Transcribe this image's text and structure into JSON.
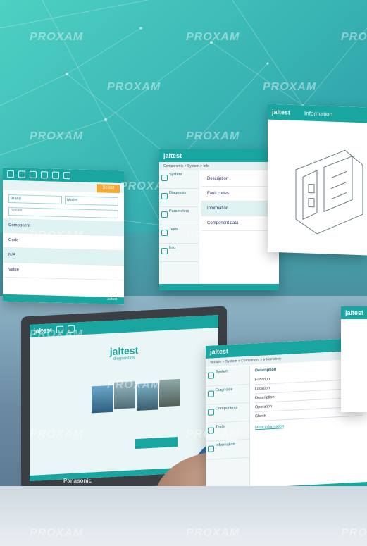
{
  "watermark": "PROXAM",
  "brand": "jaltest",
  "brand_sub": "diagnostics",
  "info_panel": {
    "title": "Information"
  },
  "left_panel": {
    "action": "Select",
    "fields": [
      "Brand",
      "Model",
      "Variant"
    ],
    "rows": [
      "Component",
      "Code",
      "N/A",
      "Value"
    ],
    "footer": "Jaltest"
  },
  "center_panel": {
    "breadcrumb": "Components > System > Info",
    "menu": [
      "System",
      "Diagnosis",
      "Parameters",
      "Tests",
      "Info"
    ],
    "content": [
      "Description",
      "Fault codes",
      "Information",
      "Component data"
    ]
  },
  "bottom_panel": {
    "breadcrumb": "Vehicle > System > Component > Information",
    "menu": [
      "System",
      "Diagnosis",
      "Components",
      "Tests",
      "Information"
    ],
    "heading": "Description",
    "lines": [
      "Function",
      "Location",
      "Description",
      "Operation",
      "Check"
    ],
    "link": "More information"
  },
  "laptop": {
    "brand": "Panasonic"
  },
  "colors": {
    "accent": "#1aa6a0",
    "sky": "#46c9bf"
  }
}
